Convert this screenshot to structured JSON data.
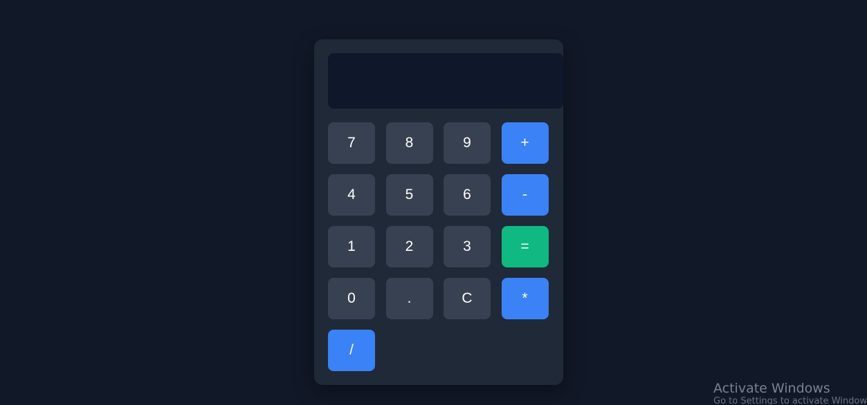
{
  "display": {
    "value": ""
  },
  "keys": [
    {
      "label": "7",
      "kind": "num",
      "name": "key-7"
    },
    {
      "label": "8",
      "kind": "num",
      "name": "key-8"
    },
    {
      "label": "9",
      "kind": "num",
      "name": "key-9"
    },
    {
      "label": "+",
      "kind": "op",
      "name": "key-add"
    },
    {
      "label": "4",
      "kind": "num",
      "name": "key-4"
    },
    {
      "label": "5",
      "kind": "num",
      "name": "key-5"
    },
    {
      "label": "6",
      "kind": "num",
      "name": "key-6"
    },
    {
      "label": "-",
      "kind": "op",
      "name": "key-subtract"
    },
    {
      "label": "1",
      "kind": "num",
      "name": "key-1"
    },
    {
      "label": "2",
      "kind": "num",
      "name": "key-2"
    },
    {
      "label": "3",
      "kind": "num",
      "name": "key-3"
    },
    {
      "label": "=",
      "kind": "eq",
      "name": "key-equals"
    },
    {
      "label": "0",
      "kind": "num",
      "name": "key-0"
    },
    {
      "label": ".",
      "kind": "num",
      "name": "key-decimal"
    },
    {
      "label": "C",
      "kind": "num",
      "name": "key-clear"
    },
    {
      "label": "*",
      "kind": "op",
      "name": "key-multiply"
    },
    {
      "label": "/",
      "kind": "op",
      "name": "key-divide"
    }
  ],
  "colors": {
    "page_background": "#111827",
    "calculator_background": "#1f2937",
    "display_background": "#0f172a",
    "number_key": "#374151",
    "operator_key": "#3b82f6",
    "equals_key": "#10b981"
  },
  "watermark": {
    "title": "Activate Windows",
    "subtitle": "Go to Settings to activate Windows."
  }
}
